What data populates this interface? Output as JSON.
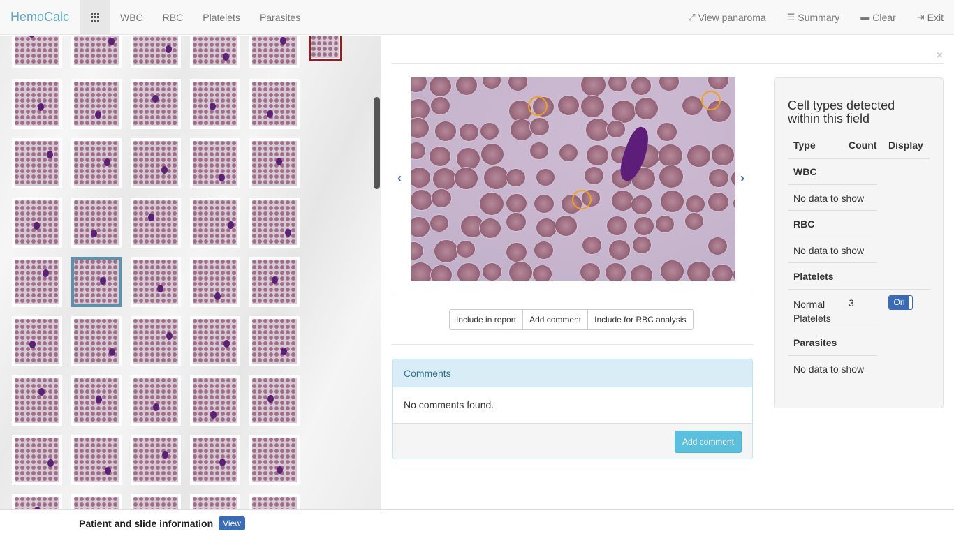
{
  "app": {
    "brand": "HemoCalc"
  },
  "nav": {
    "left": [
      "WBC",
      "RBC",
      "Platelets",
      "Parasites"
    ],
    "right": [
      {
        "icon": "expand-icon",
        "label": "View panaroma"
      },
      {
        "icon": "list-icon",
        "label": "Summary"
      },
      {
        "icon": "minus-icon",
        "label": "Clear"
      },
      {
        "icon": "exit-icon",
        "label": "Exit"
      }
    ]
  },
  "footer": {
    "label": "Patient and slide information",
    "view_button": "View"
  },
  "viewer": {
    "prev_icon": "chevron-left-icon",
    "next_icon": "chevron-right-icon",
    "close_icon": "close-icon"
  },
  "actions": [
    "Include in report",
    "Add comment",
    "Include for RBC analysis"
  ],
  "comments": {
    "heading": "Comments",
    "empty_text": "No comments found.",
    "add_button": "Add comment"
  },
  "cell_panel": {
    "title": "Cell types detected within this field",
    "headers": {
      "type": "Type",
      "count": "Count",
      "display": "Display"
    },
    "groups": [
      {
        "name": "WBC",
        "empty": "No data to show"
      },
      {
        "name": "RBC",
        "empty": "No data to show"
      },
      {
        "name": "Platelets",
        "row": {
          "type": "Normal Platelets",
          "count": "3",
          "toggle": "On"
        }
      },
      {
        "name": "Parasites",
        "empty": "No data to show"
      }
    ]
  }
}
